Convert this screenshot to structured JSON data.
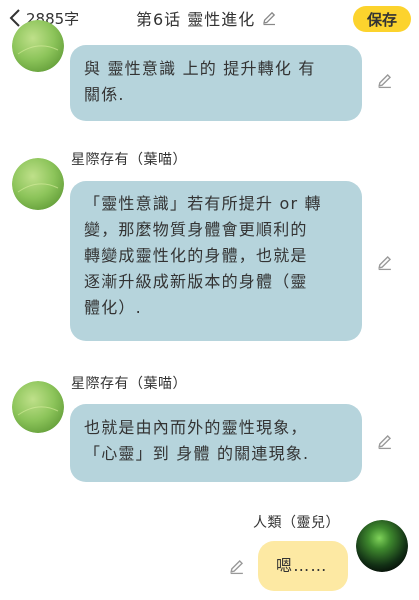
{
  "header": {
    "char_count": "2885字",
    "title": "第6话 靈性進化",
    "save_label": "保存"
  },
  "messages": [
    {
      "sender": "",
      "lines": [
        "與 靈性意識 上的 提升轉化 有",
        "關係."
      ]
    },
    {
      "sender": "星際存有（葉喵）",
      "lines": [
        "「靈性意識」若有所提升 or 轉",
        "變，那麼物質身體會更順利的",
        "轉變成靈性化的身體，也就是",
        "逐漸升級成新版本的身體（靈",
        "體化）."
      ]
    },
    {
      "sender": "星際存有（葉喵）",
      "lines": [
        "也就是由內而外的靈性現象，",
        "「心靈」到 身體 的關連現象."
      ]
    },
    {
      "sender": "人類（靈兒）",
      "lines": [
        "嗯……"
      ]
    }
  ],
  "icons": {
    "back": "chevron-left-icon",
    "edit": "pencil-icon"
  },
  "colors": {
    "save_button": "#fcd32d",
    "bubble_other": "#b6d4dc",
    "bubble_self": "#fde9a3"
  }
}
